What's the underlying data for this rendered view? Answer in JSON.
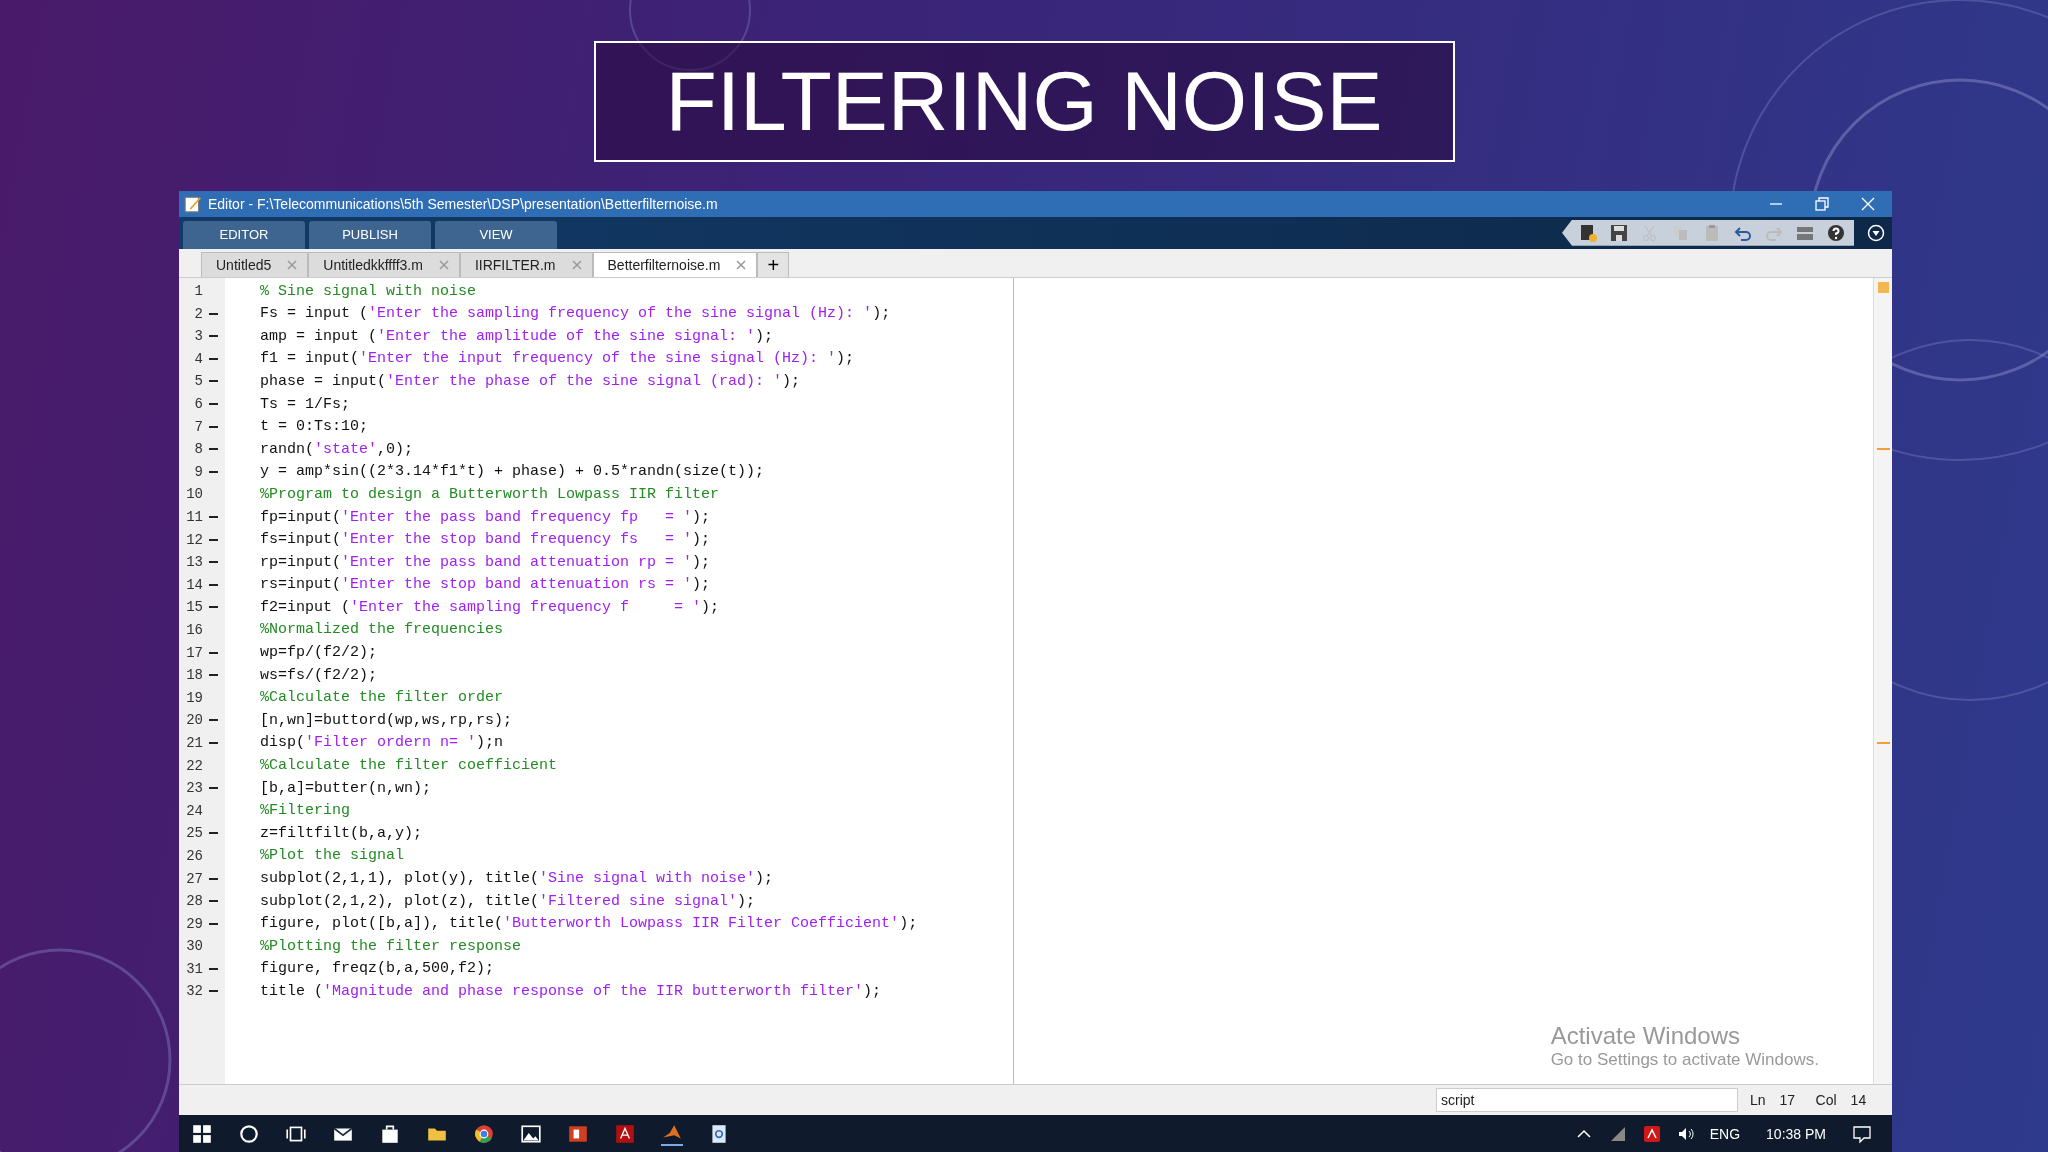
{
  "slide_title": "FILTERING NOISE",
  "window": {
    "title": "Editor - F:\\Telecommunications\\5th Semester\\DSP\\presentation\\Betterfilternoise.m"
  },
  "toolstrip_tabs": [
    {
      "label": "EDITOR",
      "selected": false
    },
    {
      "label": "PUBLISH",
      "selected": false
    },
    {
      "label": "VIEW",
      "selected": false
    }
  ],
  "file_tabs": [
    {
      "label": "Untitled5",
      "selected": false
    },
    {
      "label": "Untitledkkffff3.m",
      "selected": false
    },
    {
      "label": "IIRFILTER.m",
      "selected": false
    },
    {
      "label": "Betterfilternoise.m",
      "selected": true
    }
  ],
  "new_tab_button": "+",
  "code_lines": [
    {
      "number": "1",
      "executable": false,
      "segments": [
        {
          "kind": "comment",
          "text": "% Sine signal with noise"
        }
      ]
    },
    {
      "number": "2",
      "executable": true,
      "segments": [
        {
          "kind": "code",
          "text": "Fs = input ("
        },
        {
          "kind": "string",
          "text": "'Enter the sampling frequency of the sine signal (Hz): '"
        },
        {
          "kind": "code",
          "text": ");"
        }
      ]
    },
    {
      "number": "3",
      "executable": true,
      "segments": [
        {
          "kind": "code",
          "text": "amp = input ("
        },
        {
          "kind": "string",
          "text": "'Enter the amplitude of the sine signal: '"
        },
        {
          "kind": "code",
          "text": ");"
        }
      ]
    },
    {
      "number": "4",
      "executable": true,
      "segments": [
        {
          "kind": "code",
          "text": "f1 = input("
        },
        {
          "kind": "string",
          "text": "'Enter the input frequency of the sine signal (Hz): '"
        },
        {
          "kind": "code",
          "text": ");"
        }
      ]
    },
    {
      "number": "5",
      "executable": true,
      "segments": [
        {
          "kind": "code",
          "text": "phase = input("
        },
        {
          "kind": "string",
          "text": "'Enter the phase of the sine signal (rad): '"
        },
        {
          "kind": "code",
          "text": ");"
        }
      ]
    },
    {
      "number": "6",
      "executable": true,
      "segments": [
        {
          "kind": "code",
          "text": "Ts = 1/Fs;"
        }
      ]
    },
    {
      "number": "7",
      "executable": true,
      "segments": [
        {
          "kind": "code",
          "text": "t = 0:Ts:10;"
        }
      ]
    },
    {
      "number": "8",
      "executable": true,
      "segments": [
        {
          "kind": "code",
          "text": "randn("
        },
        {
          "kind": "string",
          "text": "'state'"
        },
        {
          "kind": "code",
          "text": ",0);"
        }
      ]
    },
    {
      "number": "9",
      "executable": true,
      "segments": [
        {
          "kind": "code",
          "text": "y = amp*sin((2*3.14*f1*t) + phase) + 0.5*randn(size(t));"
        }
      ]
    },
    {
      "number": "10",
      "executable": false,
      "segments": [
        {
          "kind": "comment",
          "text": "%Program to design a Butterworth Lowpass IIR filter"
        }
      ]
    },
    {
      "number": "11",
      "executable": true,
      "segments": [
        {
          "kind": "code",
          "text": "fp=input("
        },
        {
          "kind": "string",
          "text": "'Enter the pass band frequency fp   = '"
        },
        {
          "kind": "code",
          "text": ");"
        }
      ]
    },
    {
      "number": "12",
      "executable": true,
      "segments": [
        {
          "kind": "code",
          "text": "fs=input("
        },
        {
          "kind": "string",
          "text": "'Enter the stop band frequency fs   = '"
        },
        {
          "kind": "code",
          "text": ");"
        }
      ]
    },
    {
      "number": "13",
      "executable": true,
      "segments": [
        {
          "kind": "code",
          "text": "rp=input("
        },
        {
          "kind": "string",
          "text": "'Enter the pass band attenuation rp = '"
        },
        {
          "kind": "code",
          "text": ");"
        }
      ]
    },
    {
      "number": "14",
      "executable": true,
      "segments": [
        {
          "kind": "code",
          "text": "rs=input("
        },
        {
          "kind": "string",
          "text": "'Enter the stop band attenuation rs = '"
        },
        {
          "kind": "code",
          "text": ");"
        }
      ]
    },
    {
      "number": "15",
      "executable": true,
      "segments": [
        {
          "kind": "code",
          "text": "f2=input ("
        },
        {
          "kind": "string",
          "text": "'Enter the sampling frequency f     = '"
        },
        {
          "kind": "code",
          "text": ");"
        }
      ]
    },
    {
      "number": "16",
      "executable": false,
      "segments": [
        {
          "kind": "comment",
          "text": "%Normalized the frequencies"
        }
      ]
    },
    {
      "number": "17",
      "executable": true,
      "segments": [
        {
          "kind": "code",
          "text": "wp=fp/(f2/2);"
        }
      ]
    },
    {
      "number": "18",
      "executable": true,
      "segments": [
        {
          "kind": "code",
          "text": "ws=fs/(f2/2);"
        }
      ]
    },
    {
      "number": "19",
      "executable": false,
      "segments": [
        {
          "kind": "comment",
          "text": "%Calculate the filter order"
        }
      ]
    },
    {
      "number": "20",
      "executable": true,
      "segments": [
        {
          "kind": "code",
          "text": "[n,wn]=buttord(wp,ws,rp,rs);"
        }
      ]
    },
    {
      "number": "21",
      "executable": true,
      "segments": [
        {
          "kind": "code",
          "text": "disp("
        },
        {
          "kind": "string",
          "text": "'Filter ordern n= '"
        },
        {
          "kind": "code",
          "text": ");n"
        }
      ]
    },
    {
      "number": "22",
      "executable": false,
      "segments": [
        {
          "kind": "comment",
          "text": "%Calculate the filter coefficient"
        }
      ]
    },
    {
      "number": "23",
      "executable": true,
      "segments": [
        {
          "kind": "code",
          "text": "[b,a]=butter(n,wn);"
        }
      ]
    },
    {
      "number": "24",
      "executable": false,
      "segments": [
        {
          "kind": "comment",
          "text": "%Filtering"
        }
      ]
    },
    {
      "number": "25",
      "executable": true,
      "segments": [
        {
          "kind": "code",
          "text": "z=filtfilt(b,a,y);"
        }
      ]
    },
    {
      "number": "26",
      "executable": false,
      "segments": [
        {
          "kind": "comment",
          "text": "%Plot the signal"
        }
      ]
    },
    {
      "number": "27",
      "executable": true,
      "segments": [
        {
          "kind": "code",
          "text": "subplot(2,1,1), plot(y), title("
        },
        {
          "kind": "string",
          "text": "'Sine signal with noise'"
        },
        {
          "kind": "code",
          "text": ");"
        }
      ]
    },
    {
      "number": "28",
      "executable": true,
      "segments": [
        {
          "kind": "code",
          "text": "subplot(2,1,2), plot(z), title("
        },
        {
          "kind": "string",
          "text": "'Filtered sine signal'"
        },
        {
          "kind": "code",
          "text": ");"
        }
      ]
    },
    {
      "number": "29",
      "executable": true,
      "segments": [
        {
          "kind": "code",
          "text": "figure, plot([b,a]), title("
        },
        {
          "kind": "string",
          "text": "'Butterworth Lowpass IIR Filter Coefficient'"
        },
        {
          "kind": "code",
          "text": ");"
        }
      ]
    },
    {
      "number": "30",
      "executable": false,
      "segments": [
        {
          "kind": "comment",
          "text": "%Plotting the filter response"
        }
      ]
    },
    {
      "number": "31",
      "executable": true,
      "segments": [
        {
          "kind": "code",
          "text": "figure, freqz(b,a,500,f2);"
        }
      ]
    },
    {
      "number": "32",
      "executable": true,
      "segments": [
        {
          "kind": "code",
          "text": "title ("
        },
        {
          "kind": "string",
          "text": "'Magnitude and phase response of the IIR butterworth filter'"
        },
        {
          "kind": "code",
          "text": ");"
        }
      ]
    }
  ],
  "activation_notice": {
    "title": "Activate Windows",
    "subtitle": "Go to Settings to activate Windows."
  },
  "status_bar": {
    "file_type": "script",
    "line_label": "Ln",
    "line": "17",
    "col_label": "Col",
    "col": "14"
  },
  "taskbar": {
    "language": "ENG",
    "time": "10:38 PM"
  }
}
